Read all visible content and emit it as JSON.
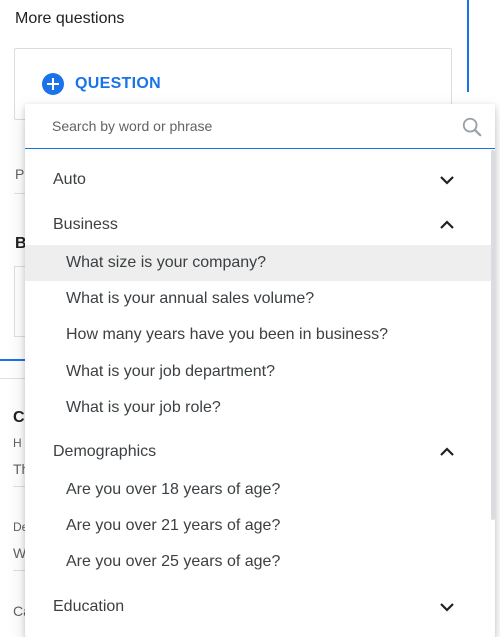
{
  "background": {
    "title": "More questions",
    "add_question_label": "QUESTION",
    "peek_letters": {
      "p": "P",
      "b": "B",
      "c1": "C",
      "h": "H",
      "th": "Th",
      "de": "De",
      "w": "W",
      "c2": "Ca"
    }
  },
  "dropdown": {
    "search_placeholder": "Search by word or phrase",
    "search_value": "",
    "categories": [
      {
        "label": "Auto",
        "expanded": false,
        "icon": "chevron-down-icon"
      },
      {
        "label": "Business",
        "expanded": true,
        "icon": "chevron-up-icon",
        "questions": [
          "What size is your company?",
          "What is your annual sales volume?",
          "How many years have you been in business?",
          "What is your job department?",
          "What is your job role?"
        ]
      },
      {
        "label": "Demographics",
        "expanded": true,
        "icon": "chevron-up-icon",
        "questions": [
          "Are you over 18 years of age?",
          "Are you over 21 years of age?",
          "Are you over 25 years of age?"
        ]
      },
      {
        "label": "Education",
        "expanded": false,
        "icon": "chevron-down-icon"
      }
    ],
    "hovered_item": "What size is your company?"
  },
  "colors": {
    "accent": "#1a73e8",
    "hover": "#eeeeee",
    "text": "#3c4043",
    "muted": "#5f6368"
  }
}
